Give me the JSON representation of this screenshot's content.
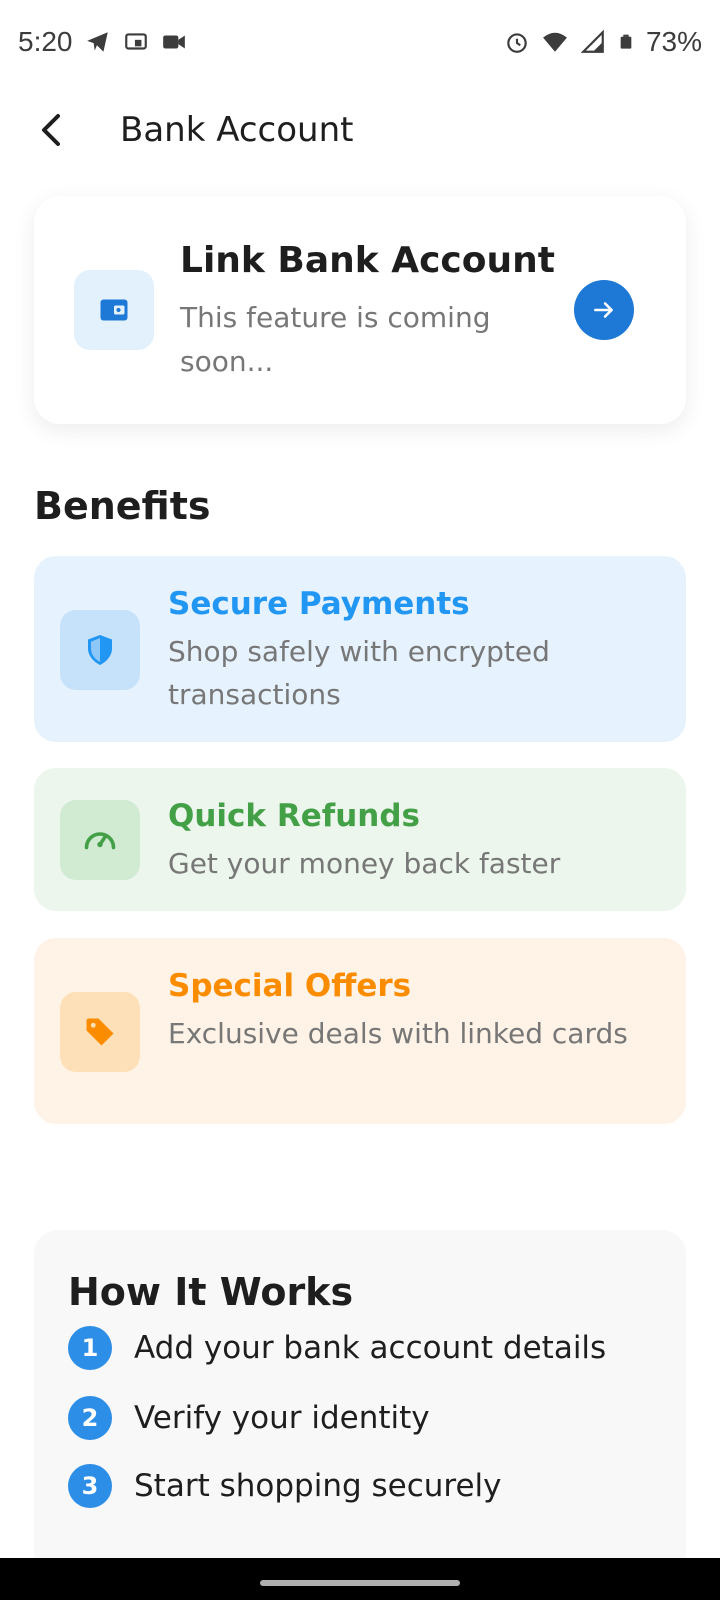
{
  "status_bar": {
    "time": "5:20",
    "battery": "73%",
    "left_icons": [
      "telegram-icon",
      "cast-icon",
      "video-icon"
    ],
    "right_icons": [
      "alarm-icon",
      "wifi-icon",
      "signal-icon",
      "battery-icon"
    ]
  },
  "header": {
    "title": "Bank Account"
  },
  "link_card": {
    "title": "Link Bank Account",
    "subtitle": "This feature is coming soon...",
    "icon": "wallet-icon",
    "accent": "#1e78d6"
  },
  "benefits": {
    "title": "Benefits",
    "items": [
      {
        "title": "Secure Payments",
        "description": "Shop safely with encrypted transactions",
        "icon": "shield-icon",
        "color": "#2196f3",
        "bg": "#e6f2fd",
        "icon_bg": "#c6e2fb"
      },
      {
        "title": "Quick Refunds",
        "description": "Get your money back faster",
        "icon": "speedometer-icon",
        "color": "#43a047",
        "bg": "#ecf6ec",
        "icon_bg": "#d1ead2"
      },
      {
        "title": "Special Offers",
        "description": "Exclusive deals with linked cards",
        "icon": "tag-icon",
        "color": "#fb8c00",
        "bg": "#fef3e6",
        "icon_bg": "#fde0b8"
      }
    ]
  },
  "how_it_works": {
    "title": "How It Works",
    "steps": [
      {
        "number": "1",
        "text": "Add your bank account details"
      },
      {
        "number": "2",
        "text": "Verify your identity"
      },
      {
        "number": "3",
        "text": "Start shopping securely"
      }
    ]
  }
}
